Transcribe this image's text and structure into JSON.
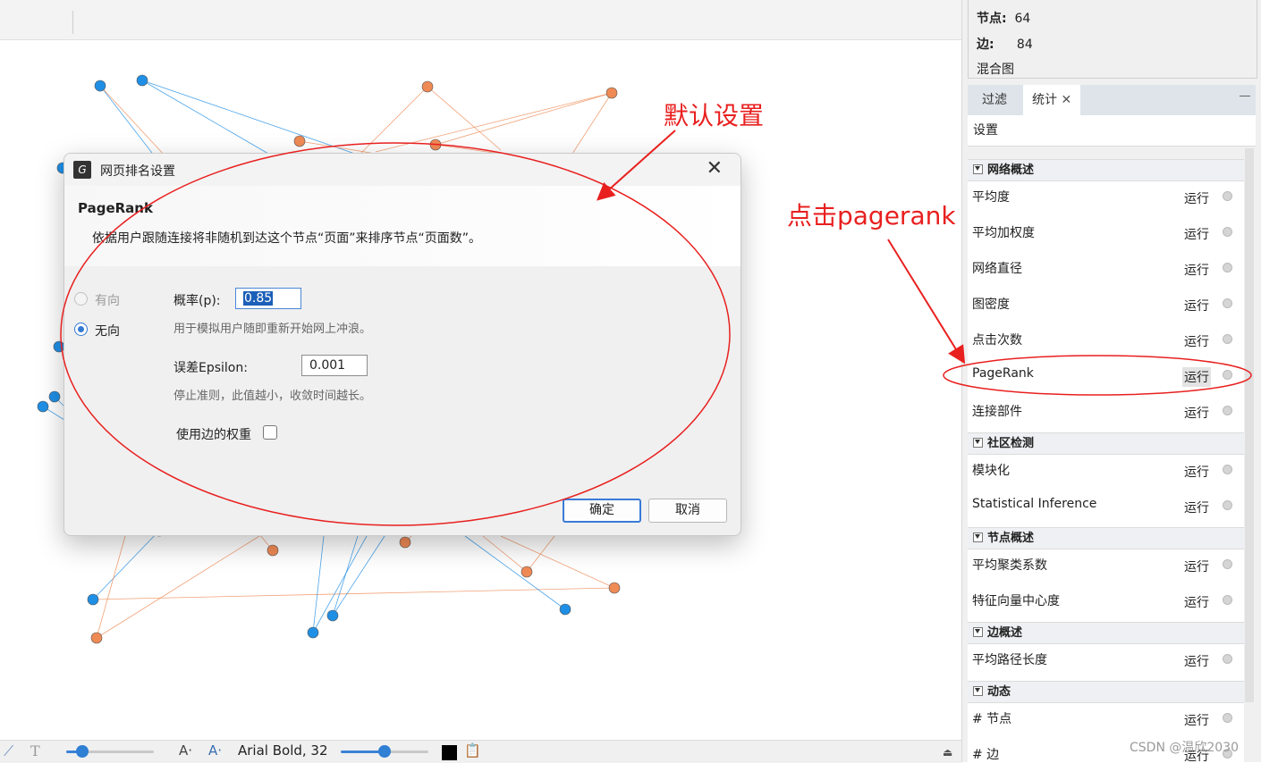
{
  "graph_info": {
    "nodes_label": "节点:",
    "nodes_value": "64",
    "edges_label": "边:",
    "edges_value": "84",
    "graph_type": "混合图"
  },
  "tabs": {
    "filter": "过滤",
    "stats": "统计",
    "close": "✕"
  },
  "settings_label": "设置",
  "run_label": "运行",
  "stats": {
    "network_overview": {
      "title": "网络概述",
      "items": [
        "平均度",
        "平均加权度",
        "网络直径",
        "图密度",
        "点击次数",
        "PageRank",
        "连接部件"
      ]
    },
    "community": {
      "title": "社区检测",
      "items": [
        "模块化",
        "Statistical Inference"
      ]
    },
    "node_overview": {
      "title": "节点概述",
      "items": [
        "平均聚类系数",
        "特征向量中心度"
      ]
    },
    "edge_overview": {
      "title": "边概述",
      "items": [
        "平均路径长度"
      ]
    },
    "dynamic": {
      "title": "动态",
      "items": [
        "# 节点",
        "# 边"
      ]
    }
  },
  "dialog": {
    "title": "网页排名设置",
    "close": "✕",
    "heading": "PageRank",
    "description": "依据用户跟随连接将非随机到达这个节点“页面”来排序节点“页面数”。",
    "directed_label": "有向",
    "undirected_label": "无向",
    "probability_label": "概率(p):",
    "probability_value": "0.85",
    "probability_hint": "用于模拟用户随即重新开始网上冲浪。",
    "epsilon_label": "误差Epsilon:",
    "epsilon_value": "0.001",
    "epsilon_hint": "停止准则，此值越小，收敛时间越长。",
    "edge_weight_label": "使用边的权重",
    "ok": "确定",
    "cancel": "取消"
  },
  "annotations": {
    "default_settings": "默认设置",
    "click_pagerank": "点击pagerank"
  },
  "bottom_bar": {
    "font_label": "Arial Bold, 32",
    "font_size_icon_1": "A·",
    "font_size_icon_2": "A·"
  },
  "watermark": "CSDN @温欣2030",
  "colors": {
    "node_blue": "#1f8fe6",
    "node_orange": "#ef8a55",
    "annotation_red": "#e8201f",
    "accent": "#3a7ad8"
  }
}
